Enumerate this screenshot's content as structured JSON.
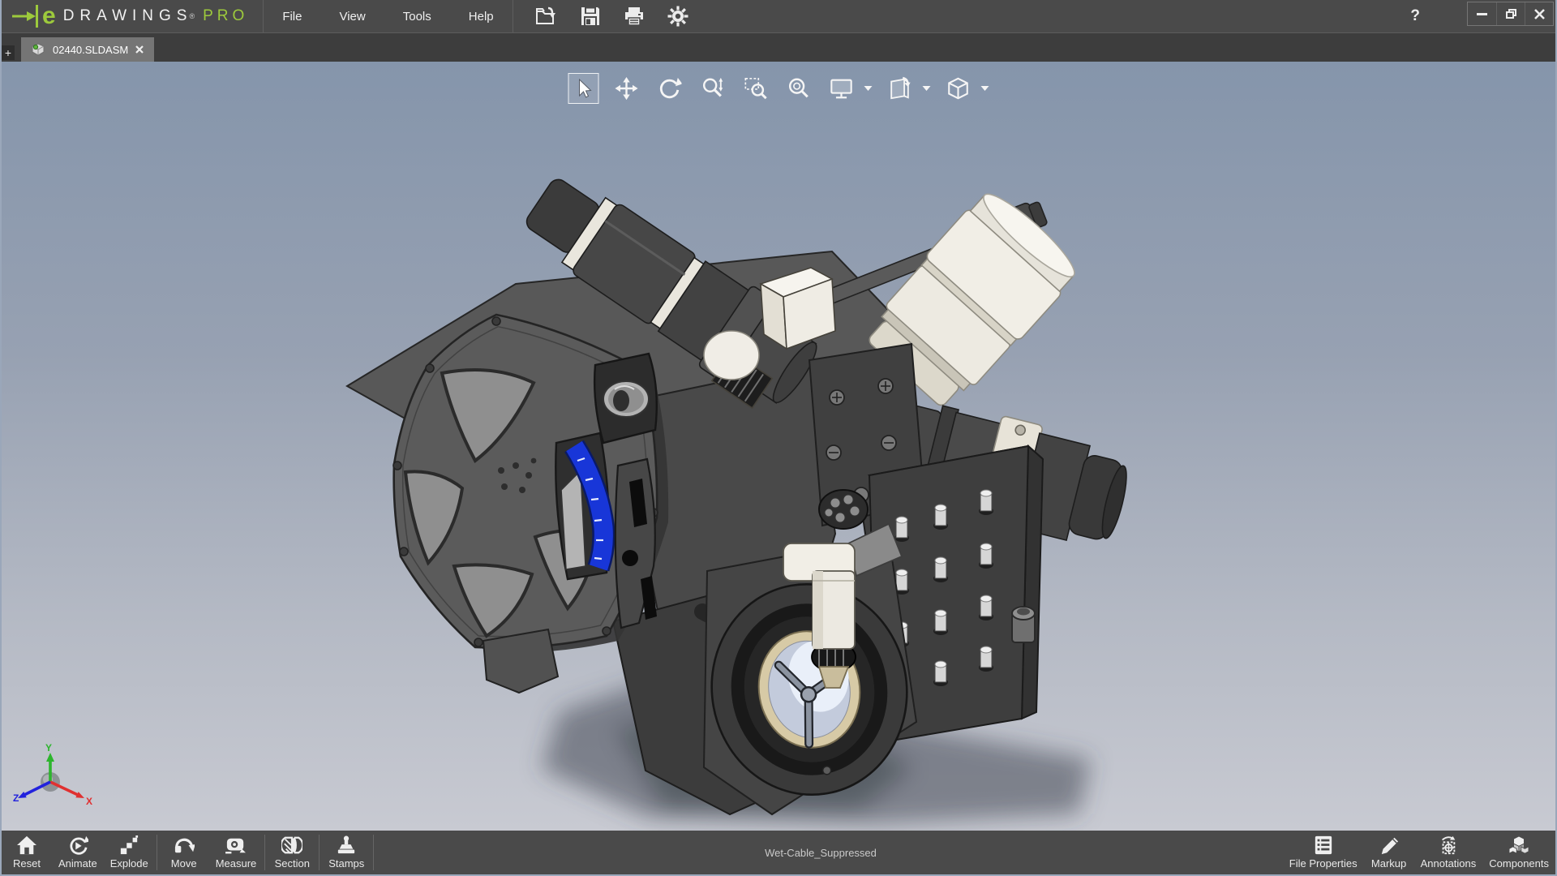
{
  "titlebar": {
    "logo": {
      "e": "e",
      "drawings": "DRAWINGS",
      "reg": "®",
      "pro": "PRO"
    },
    "menus": [
      {
        "label": "File"
      },
      {
        "label": "View"
      },
      {
        "label": "Tools"
      },
      {
        "label": "Help"
      }
    ],
    "tools": [
      {
        "name": "open-file"
      },
      {
        "name": "save"
      },
      {
        "name": "print"
      },
      {
        "name": "options"
      }
    ],
    "help": "?"
  },
  "tabbar": {
    "new_tab": "+",
    "tabs": [
      {
        "label": "02440.SLDASM",
        "active": true
      }
    ]
  },
  "view_toolbar": {
    "buttons": [
      "select",
      "pan",
      "rotate",
      "zoom",
      "zoom-area",
      "zoom-fit",
      "full-screen",
      "stamp-view",
      "orientation"
    ]
  },
  "viewport": {
    "axis": {
      "x": "X",
      "y": "Y",
      "z": "Z"
    },
    "model": "3D assembly of underwater camera unit with spool wheel, motors, strobe barrel, connector pin block and viewport ring"
  },
  "statusbar": {
    "left": [
      {
        "label": "Reset"
      },
      {
        "label": "Animate"
      },
      {
        "label": "Explode"
      },
      {
        "label": "Move"
      },
      {
        "label": "Measure"
      },
      {
        "label": "Section"
      },
      {
        "label": "Stamps"
      }
    ],
    "message": "Wet-Cable_Suppressed",
    "right": [
      {
        "label": "File Properties"
      },
      {
        "label": "Markup"
      },
      {
        "label": "Annotations"
      },
      {
        "label": "Components"
      }
    ]
  },
  "colors": {
    "chrome_gray": "#4a4a4a",
    "accent_green": "#9dca3c",
    "viewport_top": "#8595ab",
    "viewport_bottom": "#c8cad2",
    "scale_blue": "#1836d8",
    "ivory_part": "#eeebe2"
  }
}
